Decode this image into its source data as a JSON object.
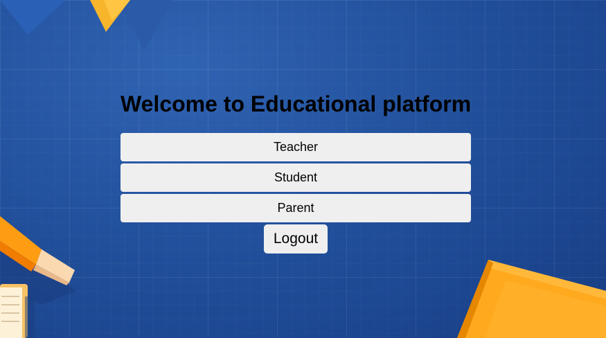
{
  "page": {
    "title": "Welcome to Educational platform"
  },
  "roles": [
    {
      "label": "Teacher"
    },
    {
      "label": "Student"
    },
    {
      "label": "Parent"
    }
  ],
  "logout": {
    "label": "Logout"
  },
  "colors": {
    "background": "#23529e",
    "button_bg": "#efefef",
    "accent_orange": "#ffa31a",
    "accent_yellow": "#f7b52c"
  },
  "decorations": {
    "top": "triangle-shapes",
    "left": "pencil-and-book-icon",
    "right": "book-icon"
  }
}
